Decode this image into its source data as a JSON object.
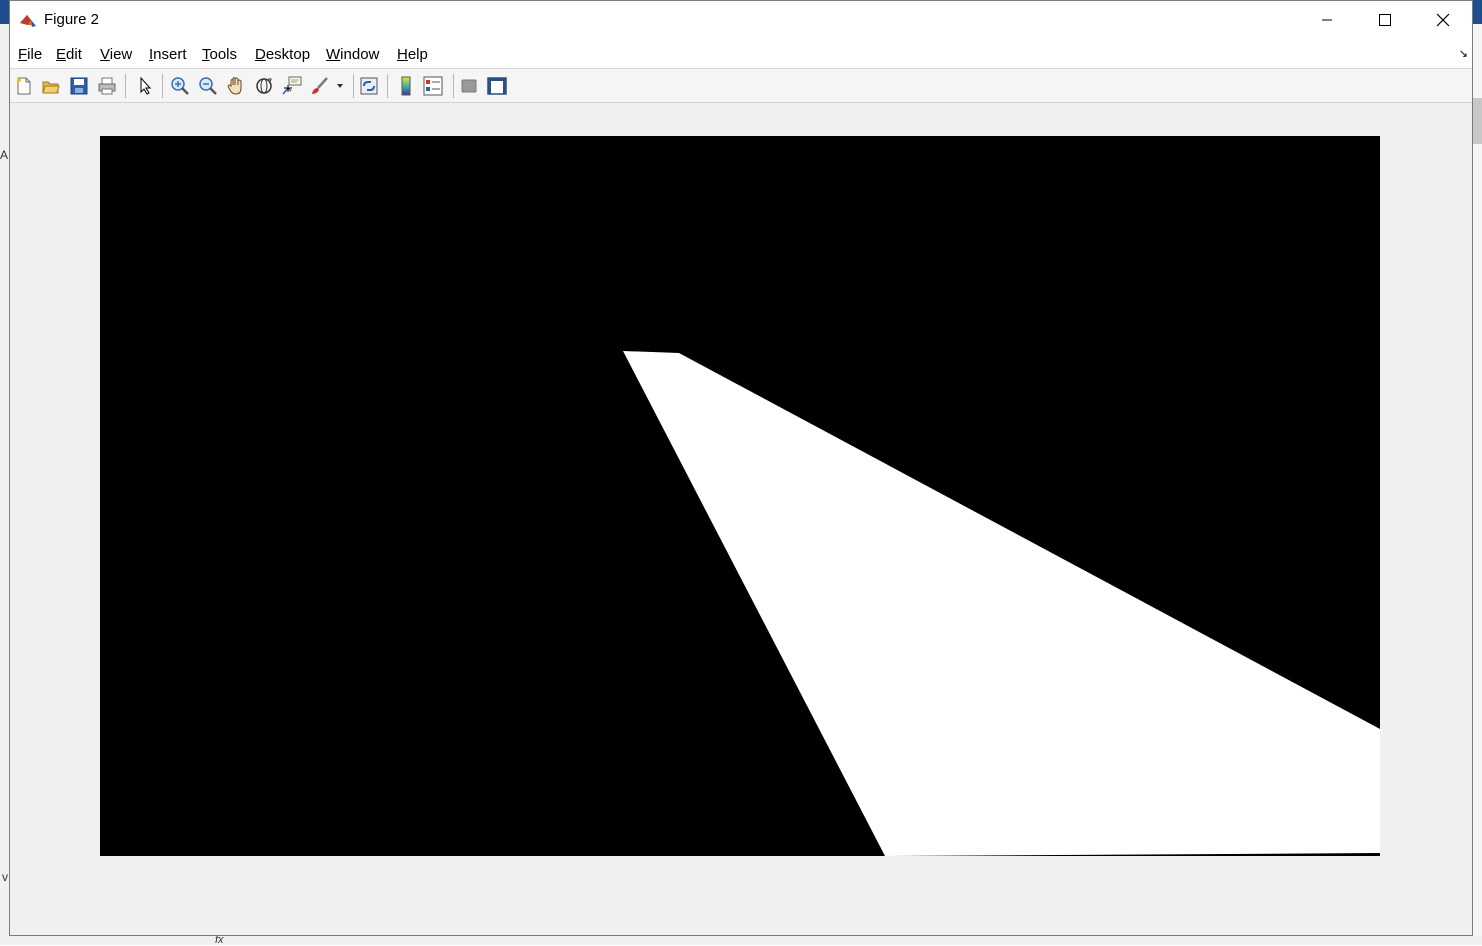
{
  "window": {
    "title": "Figure 2"
  },
  "menu": {
    "items": [
      {
        "key": "F",
        "rest": "ile"
      },
      {
        "key": "E",
        "rest": "dit"
      },
      {
        "key": "V",
        "rest": "iew"
      },
      {
        "key": "I",
        "rest": "nsert"
      },
      {
        "key": "T",
        "rest": "ools"
      },
      {
        "key": "D",
        "rest": "esktop"
      },
      {
        "key": "W",
        "rest": "indow"
      },
      {
        "key": "H",
        "rest": "elp"
      }
    ]
  },
  "toolbar": {
    "icons": [
      "new-figure-icon",
      "open-file-icon",
      "save-icon",
      "print-icon",
      "edit-plot-arrow-icon",
      "zoom-in-icon",
      "zoom-out-icon",
      "pan-hand-icon",
      "rotate-3d-icon",
      "data-cursor-icon",
      "brush-icon",
      "link-plot-icon",
      "colorbar-icon",
      "legend-icon",
      "hide-plot-tools-icon",
      "show-plot-tools-icon"
    ]
  },
  "colors": {
    "image_background": "#000000",
    "mask_foreground": "#ffffff",
    "window_background": "#f0f0f0"
  },
  "background": {
    "fx_label": "fx"
  }
}
